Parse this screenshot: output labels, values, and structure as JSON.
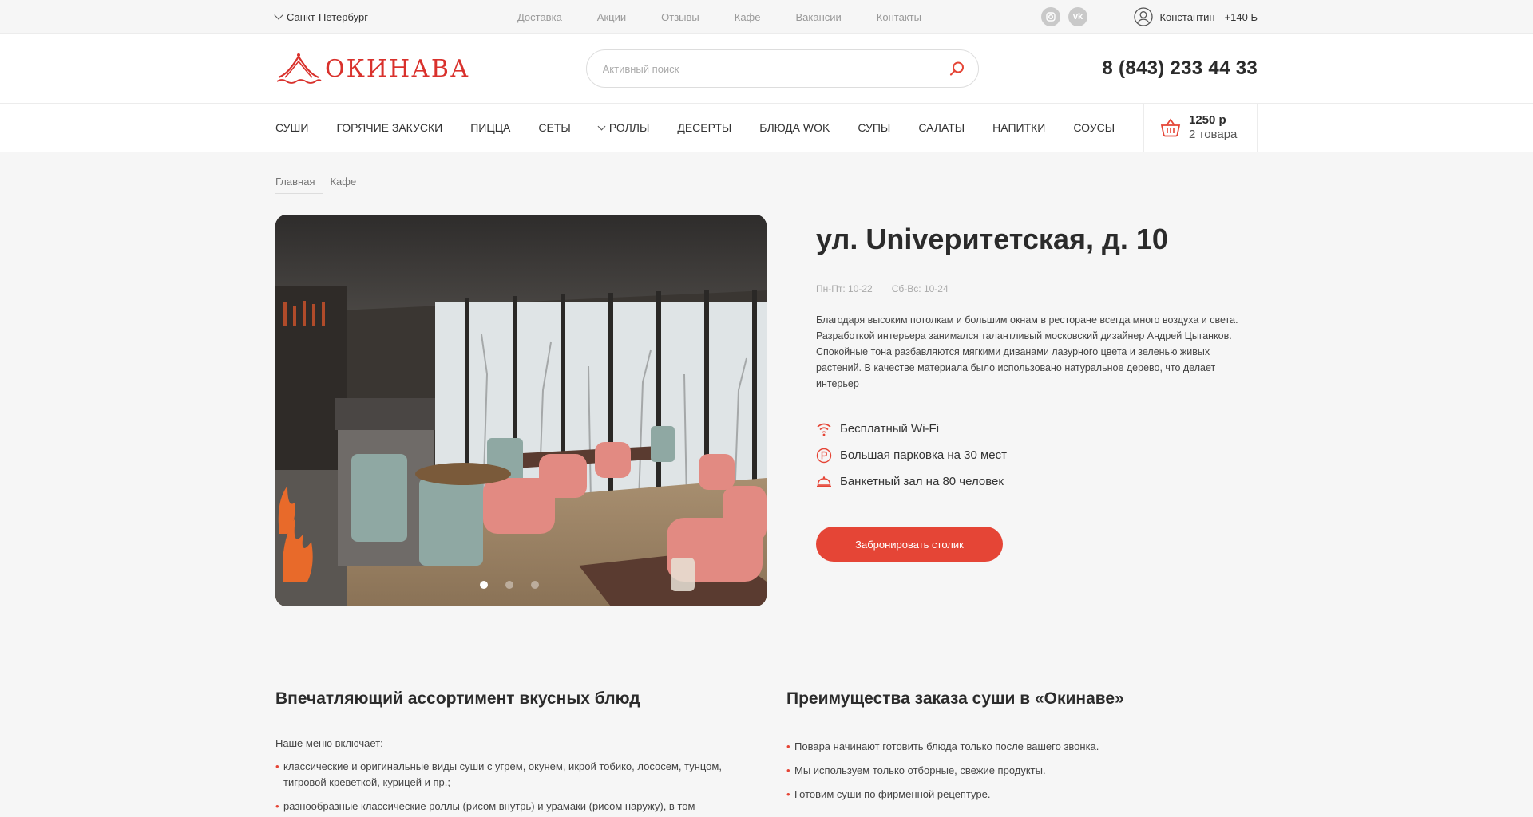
{
  "topbar": {
    "city": "Санкт-Петербург",
    "links": [
      "Доставка",
      "Акции",
      "Отзывы",
      "Кафе",
      "Вакансии",
      "Контакты"
    ],
    "social": [
      {
        "icon": "instagram-icon",
        "glyph": "◎"
      },
      {
        "icon": "vk-icon",
        "glyph": "vk"
      }
    ],
    "user_name": "Константин",
    "bonus": "+140 Б"
  },
  "header": {
    "logo_text": "ОКИНАВА",
    "search_placeholder": "Активный поиск",
    "phone": "8 (843) 233 44 33"
  },
  "categories": [
    {
      "label": "Суши",
      "dropdown": false
    },
    {
      "label": "Горячие закуски",
      "dropdown": false
    },
    {
      "label": "Пицца",
      "dropdown": false
    },
    {
      "label": "Сеты",
      "dropdown": false
    },
    {
      "label": "Роллы",
      "dropdown": true
    },
    {
      "label": "Десерты",
      "dropdown": false
    },
    {
      "label": "Блюда WOK",
      "dropdown": false
    },
    {
      "label": "Супы",
      "dropdown": false
    },
    {
      "label": "Салаты",
      "dropdown": false
    },
    {
      "label": "Напитки",
      "dropdown": false
    },
    {
      "label": "Соусы",
      "dropdown": false
    }
  ],
  "cart": {
    "sum": "1250 р",
    "count": "2 товара"
  },
  "breadcrumbs": [
    "Главная",
    "Кафе"
  ],
  "cafe": {
    "title": "ул. Univeритетская, д. 10",
    "hours_weekdays": "Пн-Пт: 10-22",
    "hours_weekend": "Сб-Вс: 10-24",
    "description": "Благодаря высоким потолкам и большим окнам в ресторане всегда много воздуха и света. Разработкой интерьера занимался талантливый московский дизайнер Андрей Цыганков. Спокойные тона разбавляются мягкими диванами лазурного цвета и зеленью живых растений. В качестве материала было использовано натуральное дерево, что делает интерьер",
    "features": [
      {
        "icon": "wifi-icon",
        "label": "Бесплатный Wi-Fi"
      },
      {
        "icon": "parking-icon",
        "label": "Большая парковка на 30 мест"
      },
      {
        "icon": "banquet-icon",
        "label": "Банкетный зал на 80 человек"
      }
    ],
    "book_button": "Забронировать столик",
    "slider_active": 1,
    "slider_total": 3
  },
  "assortment": {
    "title": "Впечатляющий ассортимент вкусных блюд",
    "lead": "Наше меню включает:",
    "items": [
      "классические и оригинальные виды суши с угрем, окунем, икрой тобико, лососем, тунцом, тигровой креветкой, курицей и пр.;",
      "разнообразные классические роллы (рисом внутрь) и урамаки (рисом наружу), в том числе"
    ]
  },
  "advantages": {
    "title": "Преимущества заказа суши в «Окинаве»",
    "items": [
      "Повара начинают готовить блюда только после вашего звонка.",
      "Мы используем только отборные, свежие продукты.",
      "Готовим суши по фирменной рецептуре."
    ]
  },
  "colors": {
    "accent": "#e54536",
    "text": "#2b2b2b",
    "muted": "#999999"
  }
}
